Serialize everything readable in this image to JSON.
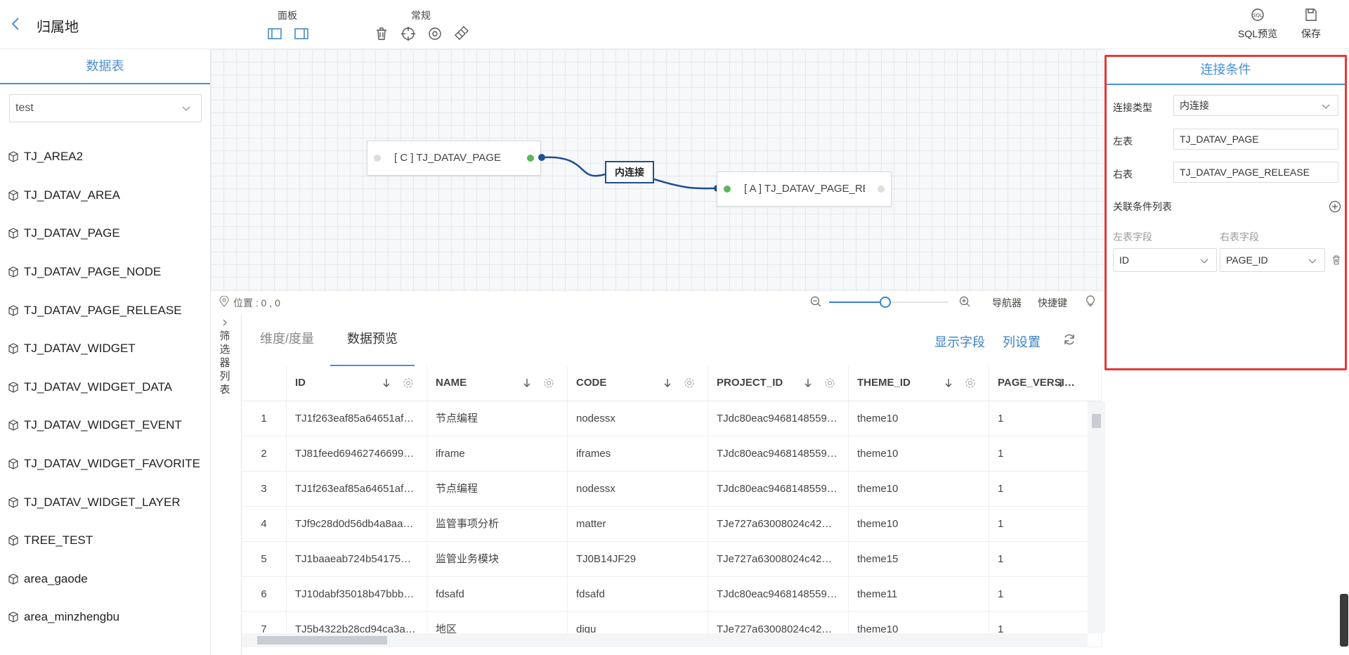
{
  "header": {
    "title": "归属地",
    "groups": {
      "panel": "面板",
      "general": "常规"
    },
    "sql_preview": "SQL预览",
    "save": "保存"
  },
  "left": {
    "title": "数据表",
    "database": "test",
    "tables": [
      "TJ_AREA2",
      "TJ_DATAV_AREA",
      "TJ_DATAV_PAGE",
      "TJ_DATAV_PAGE_NODE",
      "TJ_DATAV_PAGE_RELEASE",
      "TJ_DATAV_WIDGET",
      "TJ_DATAV_WIDGET_DATA",
      "TJ_DATAV_WIDGET_EVENT",
      "TJ_DATAV_WIDGET_FAVORITE",
      "TJ_DATAV_WIDGET_LAYER",
      "TREE_TEST",
      "area_gaode",
      "area_minzhengbu"
    ]
  },
  "canvas": {
    "left_node": "[ C ] TJ_DATAV_PAGE",
    "right_node": "[ A ] TJ_DATAV_PAGE_RE",
    "join_label": "内连接",
    "position": "位置 : 0 , 0",
    "navigator": "导航器",
    "shortcuts": "快捷键",
    "zoom_fraction": 0.47
  },
  "bottom": {
    "filter_label": "筛选器列表",
    "tabs": {
      "dims": "维度/度量",
      "preview": "数据预览"
    },
    "show_fields": "显示字段",
    "column_settings": "列设置",
    "columns": [
      "ID",
      "NAME",
      "CODE",
      "PROJECT_ID",
      "THEME_ID",
      "PAGE_VERSI…"
    ],
    "rows": [
      [
        "1",
        "TJ1f263eaf85a64651af…",
        "节点编程",
        "nodessx",
        "TJdc80eac9468148559…",
        "theme10",
        "1"
      ],
      [
        "2",
        "TJ81feed69462746699…",
        "iframe",
        "iframes",
        "TJdc80eac9468148559…",
        "theme10",
        "1"
      ],
      [
        "3",
        "TJ1f263eaf85a64651af…",
        "节点编程",
        "nodessx",
        "TJdc80eac9468148559…",
        "theme10",
        "1"
      ],
      [
        "4",
        "TJf9c28d0d56db4a8aa…",
        "监管事项分析",
        "matter",
        "TJe727a63008024c42…",
        "theme10",
        "1"
      ],
      [
        "5",
        "TJ1baaeab724b54175…",
        "监管业务模块",
        "TJ0B14JF29",
        "TJe727a63008024c42…",
        "theme15",
        "1"
      ],
      [
        "6",
        "TJ10dabf35018b47bbb…",
        "fdsafd",
        "fdsafd",
        "TJdc80eac9468148559…",
        "theme11",
        "1"
      ],
      [
        "7",
        "TJ5b4322b28cd94ca3a…",
        "地区",
        "diqu",
        "TJe727a63008024c42…",
        "theme10",
        "1"
      ]
    ]
  },
  "right": {
    "title": "连接条件",
    "join_type_label": "连接类型",
    "join_type": "内连接",
    "left_table_label": "左表",
    "left_table": "TJ_DATAV_PAGE",
    "right_table_label": "右表",
    "right_table": "TJ_DATAV_PAGE_RELEASE",
    "conditions_label": "关联条件列表",
    "left_field_label": "左表字段",
    "right_field_label": "右表字段",
    "left_field": "ID",
    "right_field": "PAGE_ID"
  },
  "colors": {
    "accent": "#4a90d9",
    "link": "#1d4f91",
    "highlight": "#e53935",
    "port_green": "#5cb85c"
  }
}
